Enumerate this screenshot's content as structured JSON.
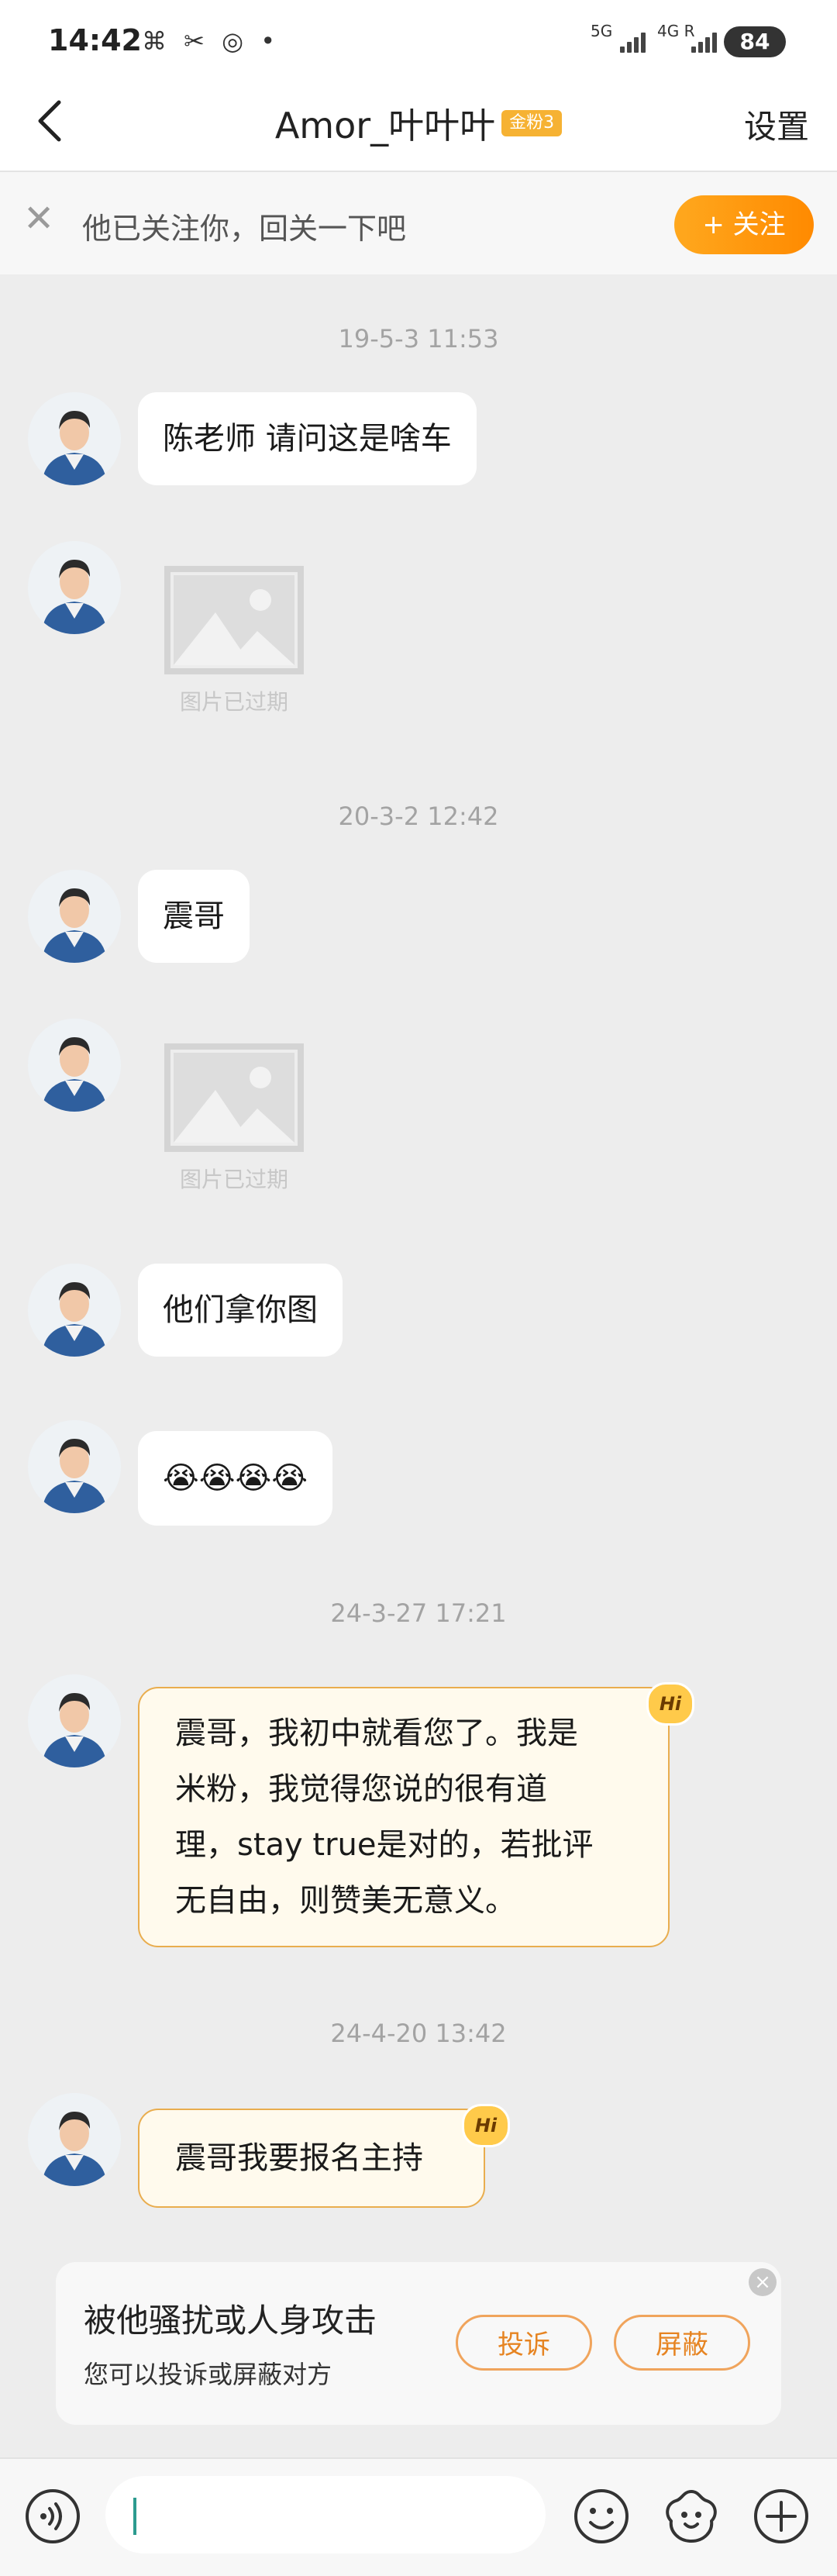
{
  "status_bar": {
    "time": "14:42",
    "left_icons": "⌘ ✂ ◎ •",
    "net1": "5G",
    "net2": "4G R",
    "battery": "84"
  },
  "nav": {
    "title": "Amor_叶叶叶",
    "badge": "金粉3",
    "settings": "设置"
  },
  "follow_banner": {
    "text": "他已关注你，回关一下吧",
    "button": "+ 关注"
  },
  "messages": {
    "t1": "19-5-3 11:53",
    "m1": "陈老师 请问这是啥车",
    "img1_caption": "图片已过期",
    "t2": "20-3-2 12:42",
    "m2": "震哥",
    "img2_caption": "图片已过期",
    "m3": "他们拿你图",
    "m4": "😭😭😭😭",
    "t3": "24-3-27 17:21",
    "m5_line1": "震哥，我初中就看您了。我是",
    "m5_line2": "米粉，我觉得您说的很有道",
    "m5_line3": "理，stay true是对的，若批评",
    "m5_line4": "无自由，则赞美无意义。",
    "t4": "24-4-20 13:42",
    "m6": "震哥我要报名主持",
    "hi": "Hi"
  },
  "report_card": {
    "heading": "被他骚扰或人身攻击",
    "sub": "您可以投诉或屏蔽对方",
    "complain": "投诉",
    "block": "屏蔽",
    "close": "×"
  },
  "input_bar": {
    "value": ""
  },
  "colors": {
    "accent_orange": "#ff8a00",
    "fan_border": "#e9ad4e",
    "background": "#ededed"
  }
}
